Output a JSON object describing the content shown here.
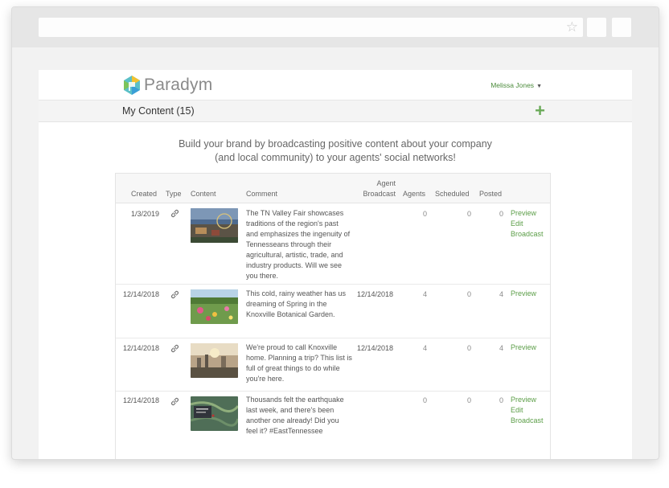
{
  "brand": {
    "name": "Paradym",
    "accent": "#5c9e48"
  },
  "user": {
    "name": "Melissa Jones"
  },
  "page": {
    "title": "My Content (15)",
    "add_icon": "plus-icon"
  },
  "tagline": {
    "line1": "Build your brand by broadcasting positive content about your company",
    "line2": "(and local community) to your agents' social networks!"
  },
  "table": {
    "headers": {
      "created": "Created",
      "type": "Type",
      "content": "Content",
      "comment": "Comment",
      "agent_broadcast_1": "Agent",
      "agent_broadcast_2": "Broadcast",
      "agents": "Agents",
      "scheduled": "Scheduled",
      "posted": "Posted"
    },
    "rows": [
      {
        "created": "1/3/2019",
        "type": "link-icon",
        "thumb": "fair-thumbnail",
        "comment": "The TN Valley Fair showcases traditions of the region's past and emphasizes the ingenuity of Tennesseans through their agricultural, artistic, trade, and industry products. Will we see you there.",
        "agent_broadcast": "",
        "agents": "0",
        "scheduled": "0",
        "posted": "0",
        "actions": [
          "Preview",
          "Edit",
          "Broadcast"
        ]
      },
      {
        "created": "12/14/2018",
        "type": "link-icon",
        "thumb": "garden-thumbnail",
        "comment": "This cold, rainy weather has us dreaming of Spring in the Knoxville Botanical Garden.",
        "agent_broadcast": "12/14/2018",
        "agents": "4",
        "scheduled": "0",
        "posted": "4",
        "actions": [
          "Preview"
        ]
      },
      {
        "created": "12/14/2018",
        "type": "link-icon",
        "thumb": "city-thumbnail",
        "comment": "We're proud to call Knoxville home. Planning a trip? This list is full of great things to do while you're here.",
        "agent_broadcast": "12/14/2018",
        "agents": "4",
        "scheduled": "0",
        "posted": "4",
        "actions": [
          "Preview"
        ]
      },
      {
        "created": "12/14/2018",
        "type": "link-icon",
        "thumb": "map-thumbnail",
        "comment": "Thousands felt the earthquake last week, and there's been another one already! Did you feel it? #EastTennessee",
        "agent_broadcast": "",
        "agents": "0",
        "scheduled": "0",
        "posted": "0",
        "actions": [
          "Preview",
          "Edit",
          "Broadcast"
        ]
      }
    ]
  }
}
